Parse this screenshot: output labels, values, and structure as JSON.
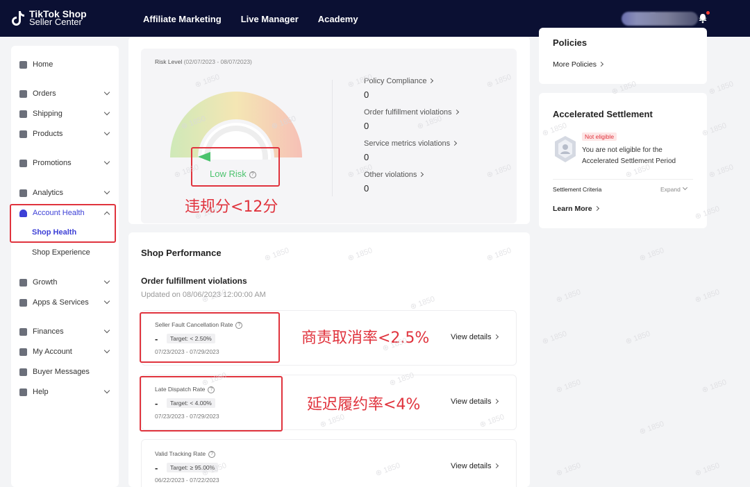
{
  "topbar": {
    "logo_line1": "TikTok Shop",
    "logo_line2": "Seller Center",
    "nav": [
      "Affiliate Marketing",
      "Live Manager",
      "Academy"
    ]
  },
  "sidebar": {
    "items": [
      {
        "label": "Home",
        "icon": "home-icon"
      },
      {
        "label": "Orders",
        "icon": "orders-icon"
      },
      {
        "label": "Shipping",
        "icon": "truck-icon"
      },
      {
        "label": "Products",
        "icon": "box-icon"
      },
      {
        "label": "Promotions",
        "icon": "megaphone-icon"
      },
      {
        "label": "Analytics",
        "icon": "chart-icon"
      },
      {
        "label": "Account Health",
        "icon": "shield-icon"
      },
      {
        "label": "Growth",
        "icon": "medal-icon"
      },
      {
        "label": "Apps & Services",
        "icon": "apps-icon"
      },
      {
        "label": "Finances",
        "icon": "wallet-icon"
      },
      {
        "label": "My Account",
        "icon": "user-icon"
      },
      {
        "label": "Buyer Messages",
        "icon": "chat-icon"
      },
      {
        "label": "Help",
        "icon": "help-icon"
      }
    ],
    "sub_shop_health": "Shop Health",
    "sub_shop_experience": "Shop Experience"
  },
  "risk": {
    "title": "Risk Level",
    "dates": "(02/07/2023 - 08/07/2023)",
    "level_label": "Low Risk",
    "violations": [
      {
        "label": "Policy Compliance",
        "value": "0"
      },
      {
        "label": "Order fulfillment violations",
        "value": "0"
      },
      {
        "label": "Service metrics violations",
        "value": "0"
      },
      {
        "label": "Other violations",
        "value": "0"
      }
    ],
    "annotation": "违规分<12分"
  },
  "performance": {
    "title": "Shop Performance",
    "subtitle": "Order fulfillment violations",
    "updated": "Updated on 08/06/2023 12:00:00 AM",
    "metrics": [
      {
        "label": "Seller Fault Cancellation Rate",
        "value": "-",
        "target": "Target: < 2.50%",
        "dates": "07/23/2023 - 07/29/2023",
        "link": "View details",
        "annotation": "商责取消率<2.5%"
      },
      {
        "label": "Late Dispatch Rate",
        "value": "-",
        "target": "Target: < 4.00%",
        "dates": "07/23/2023 - 07/29/2023",
        "link": "View details",
        "annotation": "延迟履约率<4%"
      },
      {
        "label": "Valid Tracking Rate",
        "value": "-",
        "target": "Target: ≥ 95.00%",
        "dates": "06/22/2023 - 07/22/2023",
        "link": "View details",
        "annotation": ""
      }
    ]
  },
  "policies": {
    "title": "Policies",
    "link": "More Policies"
  },
  "settlement": {
    "title": "Accelerated Settlement",
    "badge": "Not eligible",
    "message": "You are not eligible for the Accelerated Settlement Period",
    "criteria": "Settlement Criteria",
    "expand": "Expand",
    "learn_more": "Learn More"
  },
  "watermark": "1850",
  "colors": {
    "brand": "#3d40d6",
    "topbar": "#0b1033",
    "low_risk": "#4cc36e",
    "annotation": "#e0333d"
  }
}
